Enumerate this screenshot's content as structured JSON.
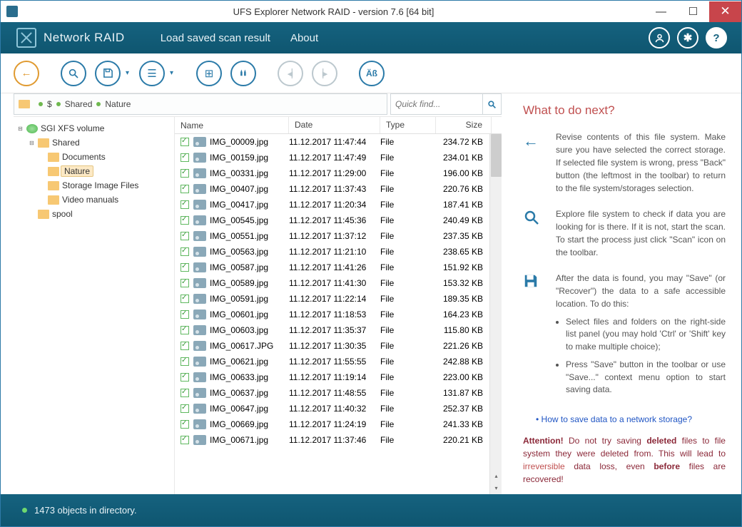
{
  "window": {
    "title": "UFS Explorer Network RAID - version 7.6 [64 bit]"
  },
  "brand": {
    "name": "Network RAID"
  },
  "menu": {
    "load": "Load saved scan result",
    "about": "About"
  },
  "breadcrumb": {
    "root": "$",
    "p1": "Shared",
    "p2": "Nature"
  },
  "quickfind": {
    "placeholder": "Quick find..."
  },
  "tree": {
    "volume": "SGI XFS volume",
    "shared": "Shared",
    "documents": "Documents",
    "nature": "Nature",
    "storage": "Storage Image Files",
    "video": "Video manuals",
    "spool": "spool"
  },
  "columns": {
    "name": "Name",
    "date": "Date",
    "type": "Type",
    "size": "Size"
  },
  "files": [
    {
      "n": "IMG_00009.jpg",
      "d": "11.12.2017 11:47:44",
      "t": "File",
      "s": "234.72 KB"
    },
    {
      "n": "IMG_00159.jpg",
      "d": "11.12.2017 11:47:49",
      "t": "File",
      "s": "234.01 KB"
    },
    {
      "n": "IMG_00331.jpg",
      "d": "11.12.2017 11:29:00",
      "t": "File",
      "s": "196.00 KB"
    },
    {
      "n": "IMG_00407.jpg",
      "d": "11.12.2017 11:37:43",
      "t": "File",
      "s": "220.76 KB"
    },
    {
      "n": "IMG_00417.jpg",
      "d": "11.12.2017 11:20:34",
      "t": "File",
      "s": "187.41 KB"
    },
    {
      "n": "IMG_00545.jpg",
      "d": "11.12.2017 11:45:36",
      "t": "File",
      "s": "240.49 KB"
    },
    {
      "n": "IMG_00551.jpg",
      "d": "11.12.2017 11:37:12",
      "t": "File",
      "s": "237.35 KB"
    },
    {
      "n": "IMG_00563.jpg",
      "d": "11.12.2017 11:21:10",
      "t": "File",
      "s": "238.65 KB"
    },
    {
      "n": "IMG_00587.jpg",
      "d": "11.12.2017 11:41:26",
      "t": "File",
      "s": "151.92 KB"
    },
    {
      "n": "IMG_00589.jpg",
      "d": "11.12.2017 11:41:30",
      "t": "File",
      "s": "153.32 KB"
    },
    {
      "n": "IMG_00591.jpg",
      "d": "11.12.2017 11:22:14",
      "t": "File",
      "s": "189.35 KB"
    },
    {
      "n": "IMG_00601.jpg",
      "d": "11.12.2017 11:18:53",
      "t": "File",
      "s": "164.23 KB"
    },
    {
      "n": "IMG_00603.jpg",
      "d": "11.12.2017 11:35:37",
      "t": "File",
      "s": "115.80 KB"
    },
    {
      "n": "IMG_00617.JPG",
      "d": "11.12.2017 11:30:35",
      "t": "File",
      "s": "221.26 KB"
    },
    {
      "n": "IMG_00621.jpg",
      "d": "11.12.2017 11:55:55",
      "t": "File",
      "s": "242.88 KB"
    },
    {
      "n": "IMG_00633.jpg",
      "d": "11.12.2017 11:19:14",
      "t": "File",
      "s": "223.00 KB"
    },
    {
      "n": "IMG_00637.jpg",
      "d": "11.12.2017 11:48:55",
      "t": "File",
      "s": "131.87 KB"
    },
    {
      "n": "IMG_00647.jpg",
      "d": "11.12.2017 11:40:32",
      "t": "File",
      "s": "252.37 KB"
    },
    {
      "n": "IMG_00669.jpg",
      "d": "11.12.2017 11:24:19",
      "t": "File",
      "s": "241.33 KB"
    },
    {
      "n": "IMG_00671.jpg",
      "d": "11.12.2017 11:37:46",
      "t": "File",
      "s": "220.21 KB"
    }
  ],
  "help": {
    "title": "What to do next?",
    "p1": "Revise contents of this file system. Make sure you have selected the correct storage. If selected file system is wrong, press \"Back\" button (the leftmost in the toolbar) to return to the file system/storages selection.",
    "p2": "Explore file system to check if data you are looking for is there. If it is not, start the scan. To start the process just click \"Scan\" icon on the toolbar.",
    "p3": "After the data is found, you may \"Save\" (or \"Recover\") the data to a safe accessible location. To do this:",
    "li1": "Select files and folders on the right-side list panel (you may hold 'Ctrl' or 'Shift' key to make multiple choice);",
    "li2": "Press \"Save\" button in the toolbar or use \"Save...\" context menu option to start saving data.",
    "link": "How to save data to a network storage?",
    "attn_label": "Attention!",
    "attn1": " Do not try saving ",
    "attn_b1": "deleted",
    "attn2": " files to file system they were deleted from. This will lead to ",
    "attn_b2": "irreversible",
    "attn3": " data loss, even ",
    "attn_b3": "before",
    "attn4": " files are recovered!"
  },
  "status": {
    "text": "1473 objects in directory."
  }
}
